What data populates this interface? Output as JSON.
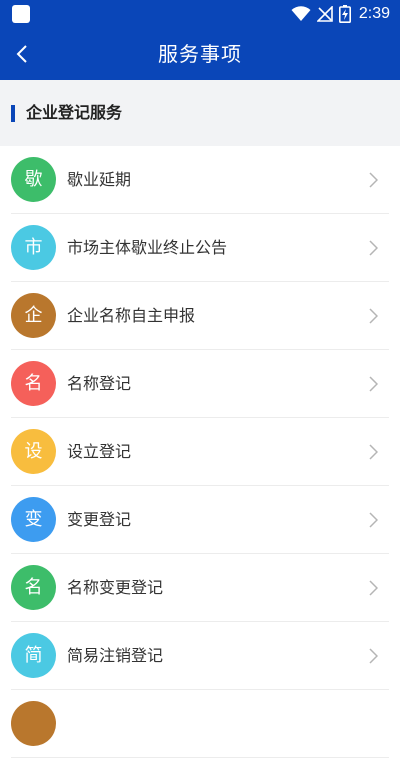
{
  "status_bar": {
    "time": "2:39",
    "icons": [
      "app-icon",
      "wifi-icon",
      "no-signal-icon",
      "battery-charging-icon"
    ]
  },
  "header": {
    "title": "服务事项",
    "back_icon": "chevron-left-icon"
  },
  "section": {
    "title": "企业登记服务"
  },
  "items": [
    {
      "icon_text": "歇",
      "label": "歇业延期",
      "color": "#3dbd6a"
    },
    {
      "icon_text": "市",
      "label": "市场主体歇业终止公告",
      "color": "#4bc9e3"
    },
    {
      "icon_text": "企",
      "label": "企业名称自主申报",
      "color": "#b9772d"
    },
    {
      "icon_text": "名",
      "label": "名称登记",
      "color": "#f5605a"
    },
    {
      "icon_text": "设",
      "label": "设立登记",
      "color": "#f8bd3e"
    },
    {
      "icon_text": "变",
      "label": "变更登记",
      "color": "#3d9cf0"
    },
    {
      "icon_text": "名",
      "label": "名称变更登记",
      "color": "#3dbd6a"
    },
    {
      "icon_text": "简",
      "label": "简易注销登记",
      "color": "#4bc9e3"
    },
    {
      "icon_text": "",
      "label": "",
      "color": "#b9772d"
    }
  ],
  "colors": {
    "primary": "#0a46b8",
    "section_bg": "#f2f3f5",
    "divider": "#ececec",
    "chevron": "#b5b5b5"
  }
}
